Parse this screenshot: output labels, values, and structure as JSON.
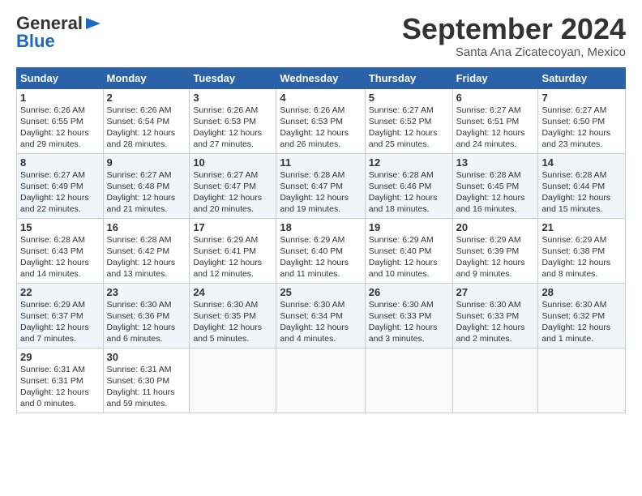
{
  "header": {
    "logo_general": "General",
    "logo_blue": "Blue",
    "month_title": "September 2024",
    "location": "Santa Ana Zicatecoyan, Mexico"
  },
  "weekdays": [
    "Sunday",
    "Monday",
    "Tuesday",
    "Wednesday",
    "Thursday",
    "Friday",
    "Saturday"
  ],
  "weeks": [
    [
      {
        "day": "1",
        "lines": [
          "Sunrise: 6:26 AM",
          "Sunset: 6:55 PM",
          "Daylight: 12 hours",
          "and 29 minutes."
        ]
      },
      {
        "day": "2",
        "lines": [
          "Sunrise: 6:26 AM",
          "Sunset: 6:54 PM",
          "Daylight: 12 hours",
          "and 28 minutes."
        ]
      },
      {
        "day": "3",
        "lines": [
          "Sunrise: 6:26 AM",
          "Sunset: 6:53 PM",
          "Daylight: 12 hours",
          "and 27 minutes."
        ]
      },
      {
        "day": "4",
        "lines": [
          "Sunrise: 6:26 AM",
          "Sunset: 6:53 PM",
          "Daylight: 12 hours",
          "and 26 minutes."
        ]
      },
      {
        "day": "5",
        "lines": [
          "Sunrise: 6:27 AM",
          "Sunset: 6:52 PM",
          "Daylight: 12 hours",
          "and 25 minutes."
        ]
      },
      {
        "day": "6",
        "lines": [
          "Sunrise: 6:27 AM",
          "Sunset: 6:51 PM",
          "Daylight: 12 hours",
          "and 24 minutes."
        ]
      },
      {
        "day": "7",
        "lines": [
          "Sunrise: 6:27 AM",
          "Sunset: 6:50 PM",
          "Daylight: 12 hours",
          "and 23 minutes."
        ]
      }
    ],
    [
      {
        "day": "8",
        "lines": [
          "Sunrise: 6:27 AM",
          "Sunset: 6:49 PM",
          "Daylight: 12 hours",
          "and 22 minutes."
        ]
      },
      {
        "day": "9",
        "lines": [
          "Sunrise: 6:27 AM",
          "Sunset: 6:48 PM",
          "Daylight: 12 hours",
          "and 21 minutes."
        ]
      },
      {
        "day": "10",
        "lines": [
          "Sunrise: 6:27 AM",
          "Sunset: 6:47 PM",
          "Daylight: 12 hours",
          "and 20 minutes."
        ]
      },
      {
        "day": "11",
        "lines": [
          "Sunrise: 6:28 AM",
          "Sunset: 6:47 PM",
          "Daylight: 12 hours",
          "and 19 minutes."
        ]
      },
      {
        "day": "12",
        "lines": [
          "Sunrise: 6:28 AM",
          "Sunset: 6:46 PM",
          "Daylight: 12 hours",
          "and 18 minutes."
        ]
      },
      {
        "day": "13",
        "lines": [
          "Sunrise: 6:28 AM",
          "Sunset: 6:45 PM",
          "Daylight: 12 hours",
          "and 16 minutes."
        ]
      },
      {
        "day": "14",
        "lines": [
          "Sunrise: 6:28 AM",
          "Sunset: 6:44 PM",
          "Daylight: 12 hours",
          "and 15 minutes."
        ]
      }
    ],
    [
      {
        "day": "15",
        "lines": [
          "Sunrise: 6:28 AM",
          "Sunset: 6:43 PM",
          "Daylight: 12 hours",
          "and 14 minutes."
        ]
      },
      {
        "day": "16",
        "lines": [
          "Sunrise: 6:28 AM",
          "Sunset: 6:42 PM",
          "Daylight: 12 hours",
          "and 13 minutes."
        ]
      },
      {
        "day": "17",
        "lines": [
          "Sunrise: 6:29 AM",
          "Sunset: 6:41 PM",
          "Daylight: 12 hours",
          "and 12 minutes."
        ]
      },
      {
        "day": "18",
        "lines": [
          "Sunrise: 6:29 AM",
          "Sunset: 6:40 PM",
          "Daylight: 12 hours",
          "and 11 minutes."
        ]
      },
      {
        "day": "19",
        "lines": [
          "Sunrise: 6:29 AM",
          "Sunset: 6:40 PM",
          "Daylight: 12 hours",
          "and 10 minutes."
        ]
      },
      {
        "day": "20",
        "lines": [
          "Sunrise: 6:29 AM",
          "Sunset: 6:39 PM",
          "Daylight: 12 hours",
          "and 9 minutes."
        ]
      },
      {
        "day": "21",
        "lines": [
          "Sunrise: 6:29 AM",
          "Sunset: 6:38 PM",
          "Daylight: 12 hours",
          "and 8 minutes."
        ]
      }
    ],
    [
      {
        "day": "22",
        "lines": [
          "Sunrise: 6:29 AM",
          "Sunset: 6:37 PM",
          "Daylight: 12 hours",
          "and 7 minutes."
        ]
      },
      {
        "day": "23",
        "lines": [
          "Sunrise: 6:30 AM",
          "Sunset: 6:36 PM",
          "Daylight: 12 hours",
          "and 6 minutes."
        ]
      },
      {
        "day": "24",
        "lines": [
          "Sunrise: 6:30 AM",
          "Sunset: 6:35 PM",
          "Daylight: 12 hours",
          "and 5 minutes."
        ]
      },
      {
        "day": "25",
        "lines": [
          "Sunrise: 6:30 AM",
          "Sunset: 6:34 PM",
          "Daylight: 12 hours",
          "and 4 minutes."
        ]
      },
      {
        "day": "26",
        "lines": [
          "Sunrise: 6:30 AM",
          "Sunset: 6:33 PM",
          "Daylight: 12 hours",
          "and 3 minutes."
        ]
      },
      {
        "day": "27",
        "lines": [
          "Sunrise: 6:30 AM",
          "Sunset: 6:33 PM",
          "Daylight: 12 hours",
          "and 2 minutes."
        ]
      },
      {
        "day": "28",
        "lines": [
          "Sunrise: 6:30 AM",
          "Sunset: 6:32 PM",
          "Daylight: 12 hours",
          "and 1 minute."
        ]
      }
    ],
    [
      {
        "day": "29",
        "lines": [
          "Sunrise: 6:31 AM",
          "Sunset: 6:31 PM",
          "Daylight: 12 hours",
          "and 0 minutes."
        ]
      },
      {
        "day": "30",
        "lines": [
          "Sunrise: 6:31 AM",
          "Sunset: 6:30 PM",
          "Daylight: 11 hours",
          "and 59 minutes."
        ]
      },
      null,
      null,
      null,
      null,
      null
    ]
  ]
}
